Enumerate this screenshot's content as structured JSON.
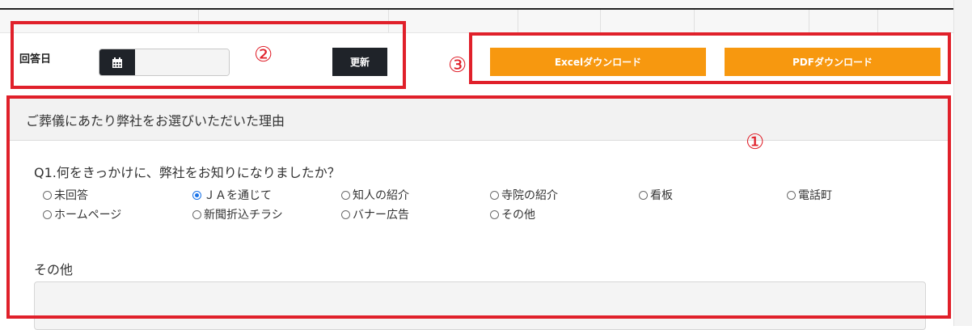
{
  "filter": {
    "date_label": "回答日",
    "date_value": "",
    "update_button": "更新"
  },
  "downloads": {
    "excel_label": "Excelダウンロード",
    "pdf_label": "PDFダウンロード"
  },
  "markers": {
    "one": "①",
    "two": "②",
    "three": "③"
  },
  "section": {
    "title": "ご葬儀にあたり弊社をお選びいただいた理由",
    "question": "Q1.何をきっかけに、弊社をお知りになりましたか？",
    "options": [
      "未回答",
      "ＪＡを通じて",
      "知人の紹介",
      "寺院の紹介",
      "看板",
      "電話町",
      "ホームページ",
      "新聞折込チラシ",
      "バナー広告",
      "その他"
    ],
    "selected_option": "ＪＡを通じて",
    "other_label": "その他",
    "other_value": ""
  },
  "colors": {
    "accent_orange": "#f7980f",
    "dark_button": "#1f2329",
    "annotation_red": "#e0202a",
    "radio_selected": "#1a73e8"
  },
  "icons": {
    "date": "calendar-icon"
  }
}
